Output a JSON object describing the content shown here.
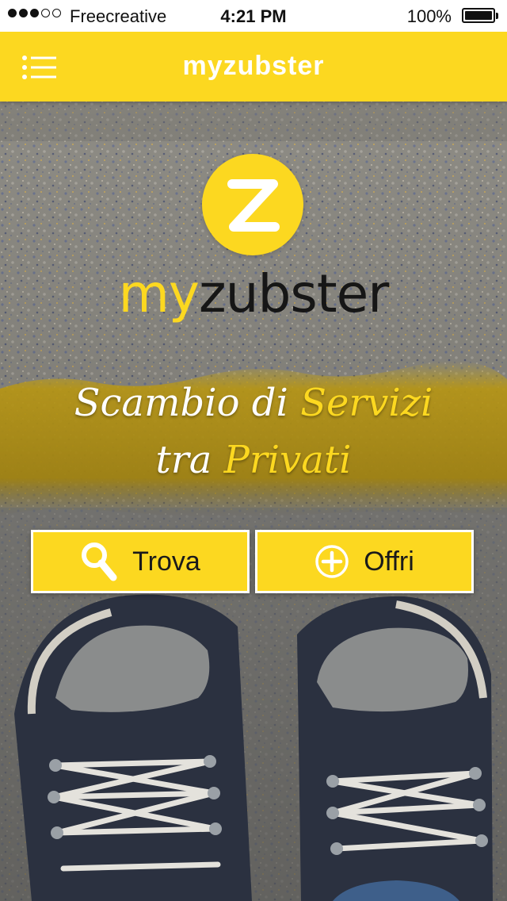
{
  "status_bar": {
    "carrier": "Freecreative",
    "time": "4:21 PM",
    "battery": "100%",
    "signal_bars_filled": 3,
    "signal_bars_total": 5
  },
  "nav": {
    "title": "myzubster",
    "menu_icon": "list-menu-icon"
  },
  "logo": {
    "letter": "Z",
    "wordmark_part1": "my",
    "wordmark_part2": "zubster"
  },
  "tagline": {
    "line1_white": "Scambio di ",
    "line1_yellow": "Servizi",
    "line2_white": "tra ",
    "line2_yellow": "Privati"
  },
  "buttons": {
    "find_label": "Trova",
    "find_icon": "search-icon",
    "offer_label": "Offri",
    "offer_icon": "plus-circle-icon"
  },
  "colors": {
    "accent": "#fcd820",
    "nav_title": "#ffffff",
    "wordmark_dark": "#161616"
  }
}
